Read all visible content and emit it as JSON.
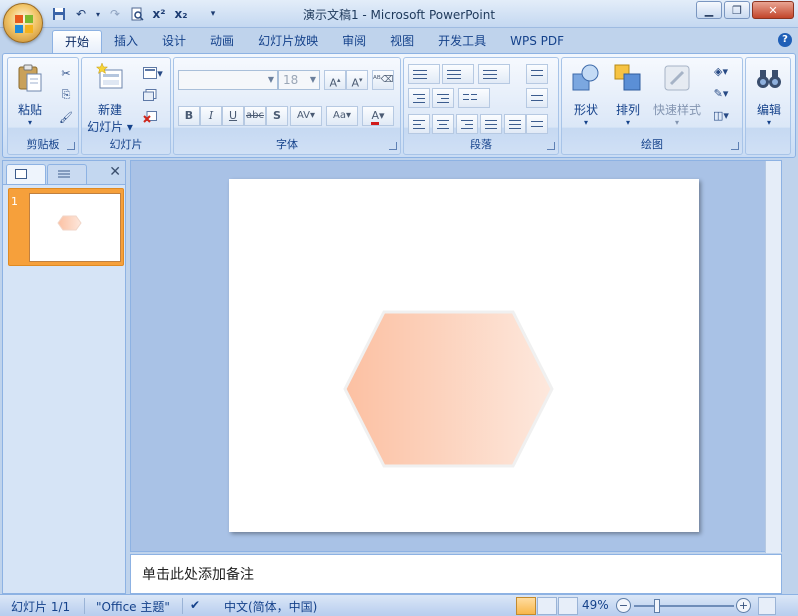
{
  "window": {
    "title": "演示文稿1 - Microsoft PowerPoint"
  },
  "tabs": [
    {
      "label": "开始",
      "active": true
    },
    {
      "label": "插入"
    },
    {
      "label": "设计"
    },
    {
      "label": "动画"
    },
    {
      "label": "幻灯片放映"
    },
    {
      "label": "审阅"
    },
    {
      "label": "视图"
    },
    {
      "label": "开发工具"
    },
    {
      "label": "WPS PDF"
    }
  ],
  "ribbon": {
    "clipboard": {
      "label": "剪贴板",
      "paste": "粘贴"
    },
    "slides": {
      "label": "幻灯片",
      "new_slide_line1": "新建",
      "new_slide_line2": "幻灯片"
    },
    "font": {
      "label": "字体",
      "font_name": "",
      "font_size": "18"
    },
    "paragraph": {
      "label": "段落"
    },
    "drawing": {
      "label": "绘图",
      "shapes": "形状",
      "arrange": "排列",
      "quick_styles": "快速样式"
    },
    "editing": {
      "label": "编辑"
    }
  },
  "slides_panel": {
    "slide_number": "1"
  },
  "notes": {
    "placeholder": "单击此处添加备注"
  },
  "status": {
    "slide_info": "幻灯片 1/1",
    "theme": "\"Office 主题\"",
    "language": "中文(简体，中国)",
    "zoom": "49%",
    "zoom_fraction": 0.49
  },
  "colors": {
    "shape_gradient_start": "#fcc0a2",
    "shape_gradient_end": "#fde8dd",
    "active_thumbnail": "#f6a03b"
  }
}
